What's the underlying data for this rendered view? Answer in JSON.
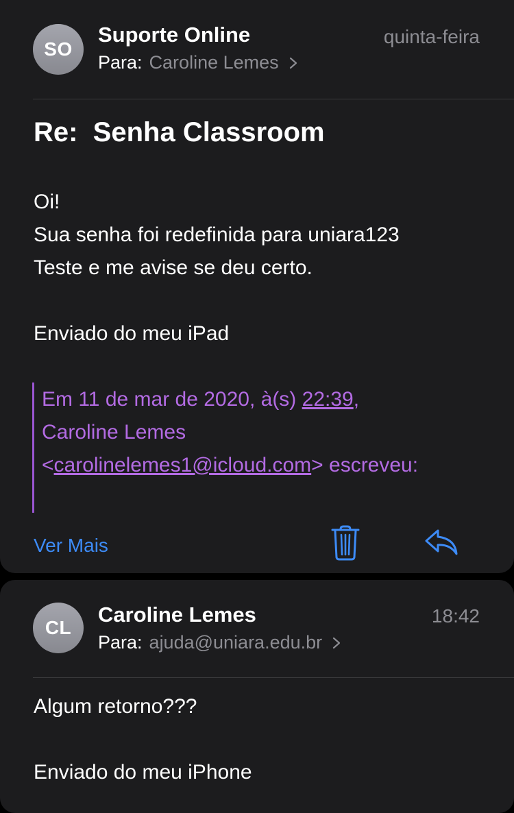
{
  "message1": {
    "avatar_initials": "SO",
    "sender": "Suporte Online",
    "date": "quinta-feira",
    "to_label": "Para:",
    "to_value": "Caroline Lemes",
    "subject": "Re:  Senha Classroom",
    "body": [
      "Oi!",
      "Sua senha foi redefinida para uniara123",
      "Teste e me avise se deu certo.",
      "Enviado do meu iPad"
    ],
    "quote": {
      "line1_prefix": "Em 11 de mar de 2020, à(s) ",
      "line1_time": "22:39",
      "line1_suffix": ",",
      "line2": "Caroline Lemes",
      "line3_open": "<",
      "line3_email": "carolinelemes1@icloud.com",
      "line3_close": "> escreveu:"
    },
    "actions": {
      "see_more": "Ver Mais",
      "trash_icon": "trash-icon",
      "reply_icon": "reply-icon"
    }
  },
  "message2": {
    "avatar_initials": "CL",
    "sender": "Caroline Lemes",
    "date": "18:42",
    "to_label": "Para:",
    "to_value": "ajuda@uniara.edu.br",
    "body": [
      "Algum retorno???",
      "Enviado do meu iPhone"
    ]
  },
  "colors": {
    "background": "#000000",
    "card": "#1c1c1e",
    "accent_blue": "#3d8bf7",
    "quote_purple": "#b36be3",
    "secondary_text": "#8d8d93"
  }
}
